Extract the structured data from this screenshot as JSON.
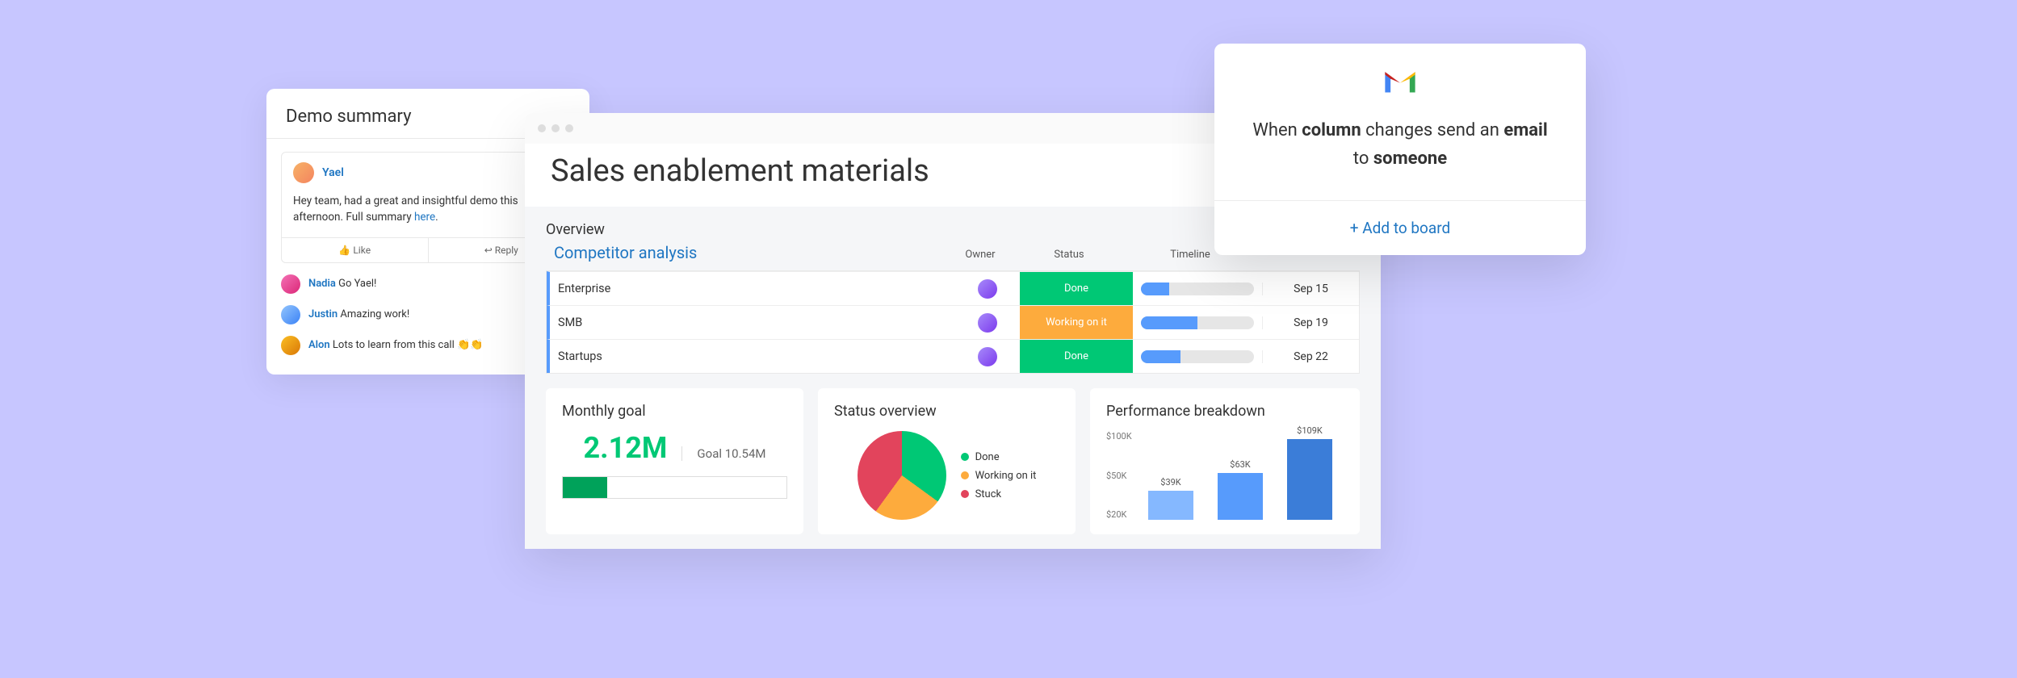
{
  "demo": {
    "title": "Demo summary",
    "post": {
      "author": "Yael",
      "body_pre": "Hey team, had a great and insightful demo this afternoon. Full summary ",
      "body_link": "here",
      "body_post": "."
    },
    "actions": {
      "like": "Like",
      "reply": "Reply"
    },
    "comments": [
      {
        "name": "Nadia",
        "text": " Go Yael!",
        "avatar_bg": "linear-gradient(135deg,#f472b6,#db2777)"
      },
      {
        "name": "Justin",
        "text": " Amazing work!",
        "avatar_bg": "linear-gradient(135deg,#93c5fd,#3b82f6)"
      },
      {
        "name": "Alon",
        "text": " Lots to learn from this call 👏👏",
        "avatar_bg": "linear-gradient(135deg,#fbbf24,#d97706)"
      }
    ]
  },
  "board": {
    "title": "Sales enablement materials",
    "overview": "Overview",
    "group": "Competitor analysis",
    "headers": {
      "owner": "Owner",
      "status": "Status",
      "timeline": "Timeline"
    },
    "rows": [
      {
        "name": "Enterprise",
        "status": "Done",
        "status_class": "status-done",
        "timeline_pct": 25,
        "date": "Sep 15"
      },
      {
        "name": "SMB",
        "status": "Working on it",
        "status_class": "status-working",
        "timeline_pct": 50,
        "date": "Sep 19"
      },
      {
        "name": "Startups",
        "status": "Done",
        "status_class": "status-done",
        "timeline_pct": 35,
        "date": "Sep 22"
      }
    ],
    "monthly_goal": {
      "title": "Monthly goal",
      "value": "2.12M",
      "target_label": "Goal 10.54M",
      "fill_pct": 20
    },
    "status_overview": {
      "title": "Status overview",
      "legend": [
        {
          "label": "Done",
          "color": "#00c875"
        },
        {
          "label": "Working on it",
          "color": "#fdab3d"
        },
        {
          "label": "Stuck",
          "color": "#e2445c"
        }
      ]
    },
    "perf": {
      "title": "Performance breakdown",
      "yticks": [
        "$100K",
        "$50K",
        "$20K"
      ],
      "bars": [
        {
          "label": "$39K",
          "h": 36,
          "color": "#85b8ff"
        },
        {
          "label": "$63K",
          "h": 58,
          "color": "#579bfc"
        },
        {
          "label": "$109K",
          "h": 100,
          "color": "#3b7dd8"
        }
      ]
    }
  },
  "chart_data": [
    {
      "type": "pie",
      "title": "Status overview",
      "series": [
        {
          "name": "Done",
          "value": 35,
          "color": "#00c875"
        },
        {
          "name": "Working on it",
          "value": 25,
          "color": "#fdab3d"
        },
        {
          "name": "Stuck",
          "value": 40,
          "color": "#e2445c"
        }
      ]
    },
    {
      "type": "bar",
      "title": "Performance breakdown",
      "categories": [
        "",
        "",
        ""
      ],
      "values": [
        39000,
        63000,
        109000
      ],
      "value_labels": [
        "$39K",
        "$63K",
        "$109K"
      ],
      "ylabel": "",
      "yticks": [
        20000,
        50000,
        100000
      ],
      "ytick_labels": [
        "$20K",
        "$50K",
        "$100K"
      ],
      "ylim": [
        0,
        110000
      ]
    }
  ],
  "automation": {
    "text_parts": [
      "When ",
      "column",
      " changes send an ",
      "email",
      " to ",
      "someone"
    ],
    "cta": "+ Add to board"
  }
}
